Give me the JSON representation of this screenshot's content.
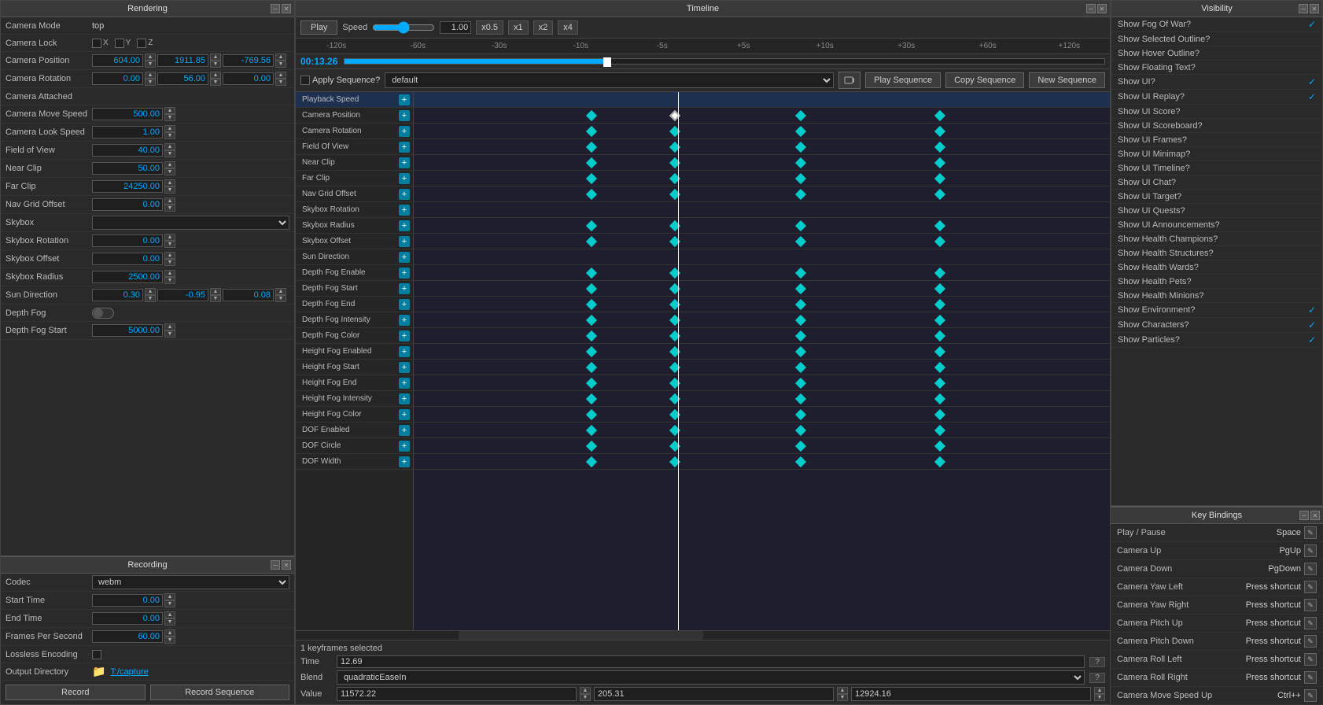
{
  "rendering": {
    "title": "Rendering",
    "fields": [
      {
        "label": "Camera Mode",
        "type": "text",
        "value": "top"
      },
      {
        "label": "Camera Lock",
        "type": "checkbox3",
        "values": [
          "X",
          "Y",
          "Z"
        ]
      },
      {
        "label": "Camera Position",
        "type": "triple",
        "values": [
          "604.00",
          "1911.85",
          "-769.56"
        ]
      },
      {
        "label": "Camera Rotation",
        "type": "triple",
        "values": [
          "0.00",
          "56.00",
          "0.00"
        ]
      },
      {
        "label": "Camera Attached",
        "type": "empty"
      },
      {
        "label": "Camera Move Speed",
        "type": "single",
        "value": "500.00"
      },
      {
        "label": "Camera Look Speed",
        "type": "single",
        "value": "1.00"
      },
      {
        "label": "Field of View",
        "type": "single",
        "value": "40.00"
      },
      {
        "label": "Near Clip",
        "type": "single",
        "value": "50.00"
      },
      {
        "label": "Far Clip",
        "type": "single",
        "value": "24250.00"
      },
      {
        "label": "Nav Grid Offset",
        "type": "single",
        "value": "0.00"
      },
      {
        "label": "Skybox",
        "type": "select",
        "value": ""
      },
      {
        "label": "Skybox Rotation",
        "type": "single",
        "value": "0.00"
      },
      {
        "label": "Skybox Offset",
        "type": "single",
        "value": "0.00"
      },
      {
        "label": "Skybox Radius",
        "type": "single",
        "value": "2500.00"
      },
      {
        "label": "Sun Direction",
        "type": "triple",
        "values": [
          "0.30",
          "-0.95",
          "0.08"
        ]
      },
      {
        "label": "Depth Fog",
        "type": "toggle"
      },
      {
        "label": "Depth Fog Start",
        "type": "single",
        "value": "5000.00"
      }
    ]
  },
  "recording": {
    "title": "Recording",
    "codec_label": "Codec",
    "codec_value": "webm",
    "start_time_label": "Start Time",
    "start_time_value": "0.00",
    "end_time_label": "End Time",
    "end_time_value": "0.00",
    "fps_label": "Frames Per Second",
    "fps_value": "60.00",
    "lossless_label": "Lossless Encoding",
    "output_label": "Output Directory",
    "output_value": "T:/capture",
    "record_btn": "Record",
    "record_seq_btn": "Record Sequence"
  },
  "timeline": {
    "title": "Timeline",
    "play_label": "Play",
    "speed_label": "Speed",
    "speed_value": "1.00",
    "presets": [
      "x0.5",
      "x1",
      "x2",
      "x4"
    ],
    "rulers": [
      "-120s",
      "-60s",
      "-30s",
      "-10s",
      "-5s",
      "+5s",
      "+10s",
      "+30s",
      "+60s",
      "+120s"
    ],
    "time_display": "00:13.26",
    "default_seq": "default",
    "apply_seq_label": "Apply Sequence?",
    "play_seq_btn": "Play Sequence",
    "copy_seq_btn": "Copy Sequence",
    "new_seq_btn": "New Sequence",
    "tracks": [
      "Playback Speed",
      "Camera Position",
      "Camera Rotation",
      "Field Of View",
      "Near Clip",
      "Far Clip",
      "Nav Grid Offset",
      "Skybox Rotation",
      "Skybox Radius",
      "Skybox Offset",
      "Sun Direction",
      "Depth Fog Enable",
      "Depth Fog Start",
      "Depth Fog End",
      "Depth Fog Intensity",
      "Depth Fog Color",
      "Height Fog Enabled",
      "Height Fog Start",
      "Height Fog End",
      "Height Fog Intensity",
      "Height Fog Color",
      "DOF Enabled",
      "DOF Circle",
      "DOF Width"
    ],
    "keyframes_selected": "1 keyframes selected",
    "time_label": "Time",
    "time_value": "12.69",
    "blend_label": "Blend",
    "blend_value": "quadraticEaseIn",
    "value_label": "Value",
    "value1": "11572.22",
    "value2": "205.31",
    "value3": "12924.16"
  },
  "visibility": {
    "title": "Visibility",
    "items": [
      {
        "label": "Show Fog Of War?",
        "checked": true
      },
      {
        "label": "Show Selected Outline?",
        "checked": false
      },
      {
        "label": "Show Hover Outline?",
        "checked": false
      },
      {
        "label": "Show Floating Text?",
        "checked": false
      },
      {
        "label": "Show UI?",
        "checked": true
      },
      {
        "label": "Show UI Replay?",
        "checked": true
      },
      {
        "label": "Show UI Score?",
        "checked": false
      },
      {
        "label": "Show UI Scoreboard?",
        "checked": false
      },
      {
        "label": "Show UI Frames?",
        "checked": false
      },
      {
        "label": "Show UI Minimap?",
        "checked": false
      },
      {
        "label": "Show UI Timeline?",
        "checked": false
      },
      {
        "label": "Show UI Chat?",
        "checked": false
      },
      {
        "label": "Show UI Target?",
        "checked": false
      },
      {
        "label": "Show UI Quests?",
        "checked": false
      },
      {
        "label": "Show UI Announcements?",
        "checked": false
      },
      {
        "label": "Show Health Champions?",
        "checked": false
      },
      {
        "label": "Show Health Structures?",
        "checked": false
      },
      {
        "label": "Show Health Wards?",
        "checked": false
      },
      {
        "label": "Show Health Pets?",
        "checked": false
      },
      {
        "label": "Show Health Minions?",
        "checked": false
      },
      {
        "label": "Show Environment?",
        "checked": true
      },
      {
        "label": "Show Characters?",
        "checked": true
      },
      {
        "label": "Show Particles?",
        "checked": true
      }
    ]
  },
  "keybindings": {
    "title": "Key Bindings",
    "items": [
      {
        "action": "Play / Pause",
        "key": "Space"
      },
      {
        "action": "Camera Up",
        "key": "PgUp"
      },
      {
        "action": "Camera Down",
        "key": "PgDown"
      },
      {
        "action": "Camera Yaw Left",
        "key": "Press shortcut"
      },
      {
        "action": "Camera Yaw Right",
        "key": "Press shortcut"
      },
      {
        "action": "Camera Pitch Up",
        "key": "Press shortcut"
      },
      {
        "action": "Camera Pitch Down",
        "key": "Press shortcut"
      },
      {
        "action": "Camera Roll Left",
        "key": "Press shortcut"
      },
      {
        "action": "Camera Roll Right",
        "key": "Press shortcut"
      },
      {
        "action": "Camera Move Speed Up",
        "key": "Ctrl++"
      }
    ]
  }
}
